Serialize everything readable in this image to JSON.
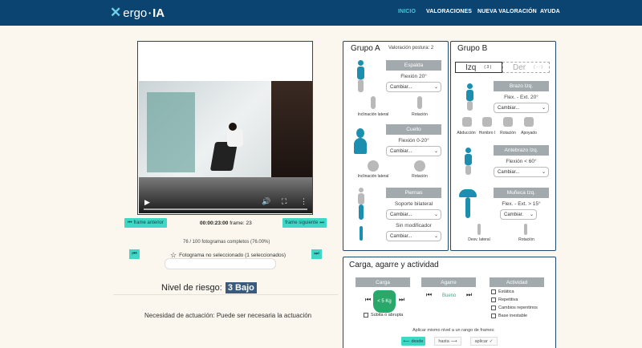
{
  "nav": {
    "logo_text": "ergo",
    "logo_suffix": "IA",
    "links": [
      "INICIO",
      "VALORACIONES",
      "NUEVA VALORACIÓN",
      "AYUDA"
    ]
  },
  "video": {
    "prev_frame": "frame anterior",
    "next_frame": "frame siguiente",
    "timecode": "00:00:23:00",
    "frame_label": "frame: 23",
    "frames_completed": "76 / 100 fotogramas completos (76.00%)",
    "frame_status": "Fotograma no seleccionado (1 seleccionados)",
    "first_icon": "skip-first-icon",
    "last_icon": "skip-last-icon"
  },
  "risk": {
    "label": "Nivel de riesgo:",
    "value": "3 Bajo",
    "necesidad": "Necesidad de actuación: Puede ser necesaria la actuación"
  },
  "grupo_a": {
    "title": "Grupo A",
    "valoracion": "Valoración postura: 2",
    "espalda": {
      "header": "Espalda",
      "value": "Flexión 20°",
      "select": "Cambiar...",
      "lateral": "Inclinación lateral",
      "rotacion": "Rotación"
    },
    "cuello": {
      "header": "Cuello",
      "value": "Flexión 0-20°",
      "select": "Cambiar...",
      "lateral": "Inclinación lateral",
      "rotacion": "Rotación"
    },
    "piernas": {
      "header": "Piernas",
      "value": "Soporte bilateral",
      "select": "Cambiar...",
      "modifier": "Sin modificador",
      "select2": "Cambiar..."
    }
  },
  "grupo_b": {
    "title": "Grupo B",
    "tab_izq": "Izq",
    "tab_izq_count": "( 3 )",
    "tab_der": "Der",
    "tab_der_count": "( - - )",
    "brazo": {
      "header": "Brazo Izq.",
      "value": "Flex. - Ext. 20°",
      "select": "Cambiar...",
      "labels": [
        "Abducción",
        "Hombro I",
        "Rotación",
        "Apoyado"
      ]
    },
    "antebrazo": {
      "header": "Antebrazo Izq.",
      "value": "Flexión < 60°",
      "select": "Cambiar..."
    },
    "muneca": {
      "header": "Muñeca Izq.",
      "value": "Flex. - Ext. > 15°",
      "select": "Cambiar.",
      "labels": [
        "Desv. lateral",
        "Rotación"
      ]
    }
  },
  "carga": {
    "title": "Carga, agarre y actividad",
    "carga_header": "Carga",
    "weight_label": "< 5 Kg",
    "subita": "Súbita o abrupta",
    "agarre_header": "Agarre",
    "agarre_value": "Bueno",
    "actividad_header": "Actividad",
    "actividad_items": [
      "Estática",
      "Repetitiva",
      "Cambios repentinos",
      "Base inestable"
    ],
    "aplicar_text": "Aplicar mismo nivel a un rango de frames:",
    "desde": "desde",
    "hasta": "hasta",
    "aplicar": "aplicar"
  },
  "colors": {
    "nav_bg": "#0b4470",
    "accent_teal": "#3ed8c4",
    "active_link": "#45c8d8",
    "panel_border": "#1e4970",
    "header_gray": "#a2aaad",
    "risk_badge": "#3b5a7c"
  }
}
